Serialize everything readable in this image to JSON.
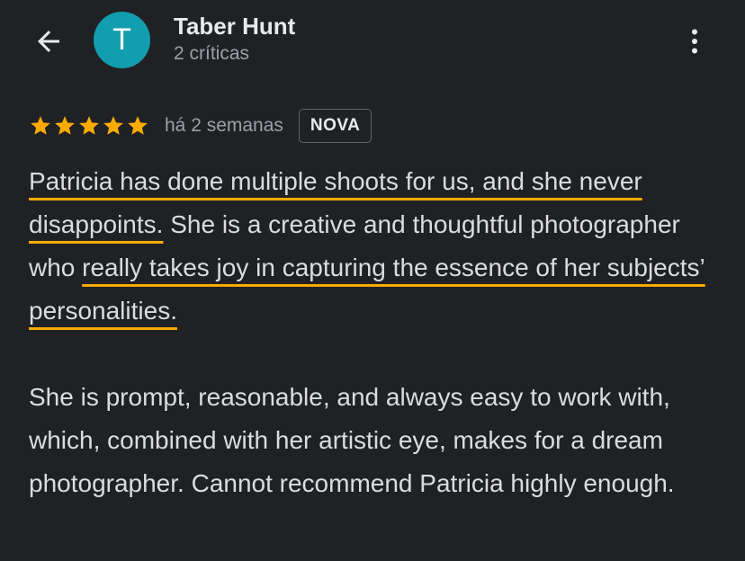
{
  "header": {
    "avatar_letter": "T",
    "reviewer_name": "Taber Hunt",
    "review_count": "2 críticas",
    "back_icon": "arrow-back-icon",
    "more_icon": "more-vert-icon"
  },
  "review": {
    "rating": 5,
    "rating_max": 5,
    "time_ago": "há 2 semanas",
    "badge": "NOVA",
    "paragraph1": [
      {
        "text": "Patricia has done multiple shoots for us, and she never disappoints.",
        "highlight": true
      },
      {
        "text": " She is a creative and thoughtful photographer who ",
        "highlight": false
      },
      {
        "text": "really takes joy in capturing the essence of her subjects’ personalities.",
        "highlight": true
      }
    ],
    "paragraph2": "She is prompt, reasonable, and always easy to work with, which, combined with her artistic eye, makes for a dream photographer. Cannot recommend Patricia highly enough."
  },
  "colors": {
    "background": "#202124",
    "avatar": "#129eaf",
    "star": "#f9ab00",
    "highlight_underline": "#f9ab00",
    "secondary_text": "#9aa0a6"
  }
}
